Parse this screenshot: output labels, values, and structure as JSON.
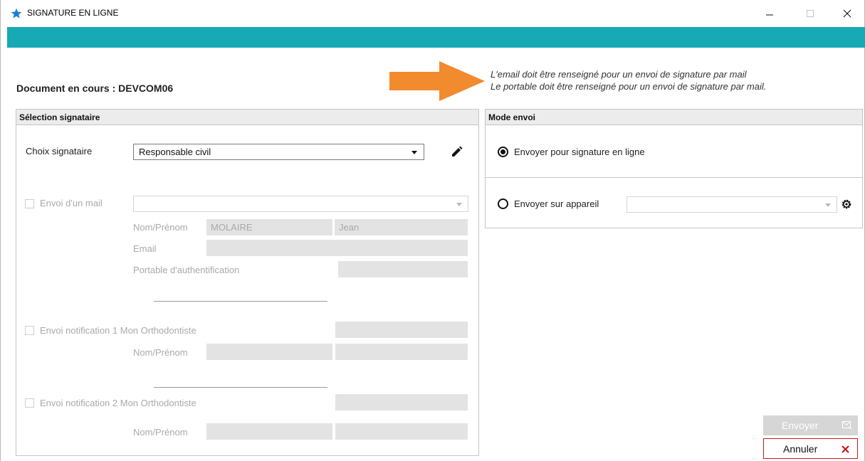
{
  "window": {
    "title": "SIGNATURE EN LIGNE"
  },
  "header": {
    "document_label": "Document en cours : DEVCOM06",
    "notice_line1": "L'email doit être renseigné pour un envoi de signature par mail",
    "notice_line2": "Le portable doit être renseigné pour un envoi de signature par mail."
  },
  "signataire": {
    "title": "Sélection signataire",
    "choix_label": "Choix signataire",
    "choix_value": "Responsable civil",
    "mail": {
      "checkbox_label": "Envoi d'un mail",
      "select_value": "",
      "nom_prenom_label": "Nom/Prénom",
      "nom_value": "MOLAIRE",
      "prenom_value": "Jean",
      "email_label": "Email",
      "email_value": "",
      "portable_label": "Portable d'authentification",
      "portable_value": ""
    },
    "notif1": {
      "checkbox_label": "Envoi notification 1 Mon Orthodontiste",
      "value": "",
      "nom_prenom_label": "Nom/Prénom",
      "nom_value": "",
      "prenom_value": ""
    },
    "notif2": {
      "checkbox_label": "Envoi notification 2 Mon Orthodontiste",
      "value": "",
      "nom_prenom_label": "Nom/Prénom",
      "nom_value": "",
      "prenom_value": ""
    }
  },
  "mode_envoi": {
    "title": "Mode envoi",
    "option_ligne": "Envoyer pour signature en ligne",
    "option_appareil": "Envoyer sur appareil",
    "selected": "ligne",
    "appareil_value": ""
  },
  "actions": {
    "envoyer": "Envoyer",
    "annuler": "Annuler"
  },
  "colors": {
    "accent_teal": "#17a9b4",
    "arrow_orange": "#f28a2e",
    "cancel_red": "#c8191e"
  }
}
